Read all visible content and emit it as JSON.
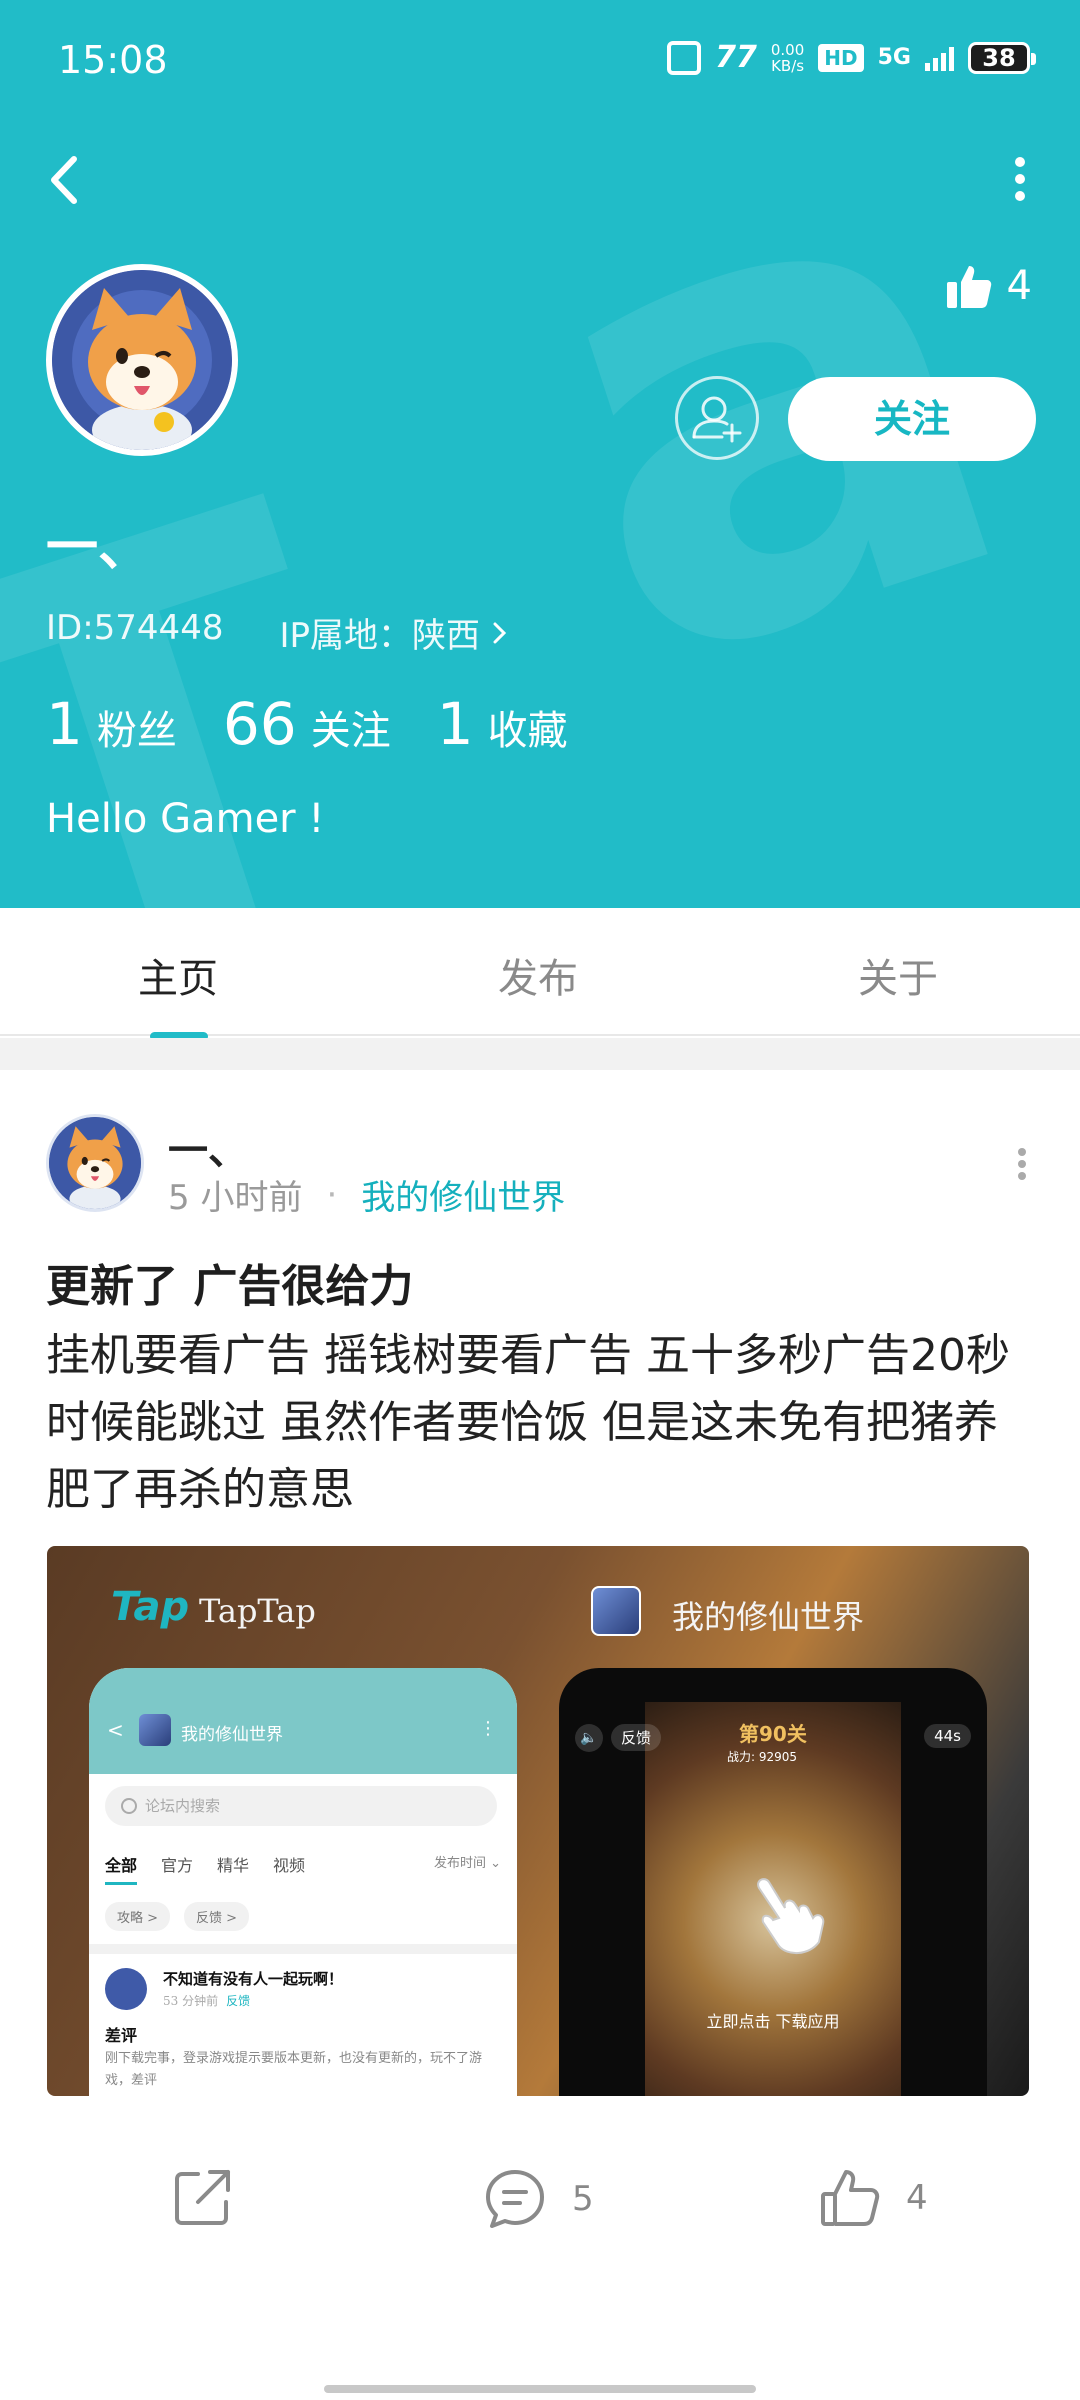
{
  "status_bar": {
    "time": "15:08",
    "net_speed": "0.00",
    "net_unit": "KB/s",
    "hd": "HD",
    "signal": "5G",
    "battery": "38"
  },
  "header": {
    "like_count": "4",
    "follow_label": "关注",
    "username": "一、",
    "user_id": "ID:574448",
    "ip_location": "IP属地：陕西",
    "stats": [
      {
        "num": "1",
        "label": "粉丝"
      },
      {
        "num": "66",
        "label": "关注"
      },
      {
        "num": "1",
        "label": "收藏"
      }
    ],
    "bio": "Hello Gamer !",
    "accent_color": "#21bcc8"
  },
  "tabs": [
    {
      "label": "主页",
      "active": true
    },
    {
      "label": "发布",
      "active": false
    },
    {
      "label": "关于",
      "active": false
    }
  ],
  "post": {
    "author": "一、",
    "time": "5 小时前",
    "separator": "·",
    "game": "我的修仙世界",
    "title": "更新了 广告很给力",
    "body": "挂机要看广告  摇钱树要看广告  五十多秒广告20秒时候能跳过   虽然作者要恰饭   但是这未免有把猪养肥了再杀的意思",
    "image": {
      "left_logo": "Tap",
      "left_brand": "TapTap",
      "right_title": "我的修仙世界",
      "left_phone": {
        "back": "<",
        "title": "我的修仙世界",
        "dots": "⋮",
        "search_placeholder": "论坛内搜索",
        "tabs": [
          "全部",
          "官方",
          "精华",
          "视频"
        ],
        "sort": "发布时间 ⌄",
        "chips": [
          "攻略 >",
          "反馈 >"
        ],
        "post_title": "不知道有没有人一起玩啊！",
        "post_time": "53 分钟前",
        "post_tag": "反馈",
        "post_heading": "差评",
        "post_body": "刚下载完事，登录游戏提示要版本更新，也没有更新的，玩不了游戏，差评"
      },
      "right_phone": {
        "level": "第90关",
        "power": "战力: 92905",
        "mute": "🔈",
        "feedback": "反馈",
        "seconds": "44s",
        "cta": "立即点击 下载应用"
      }
    },
    "actions": {
      "comment_count": "5",
      "like_count": "4"
    }
  }
}
